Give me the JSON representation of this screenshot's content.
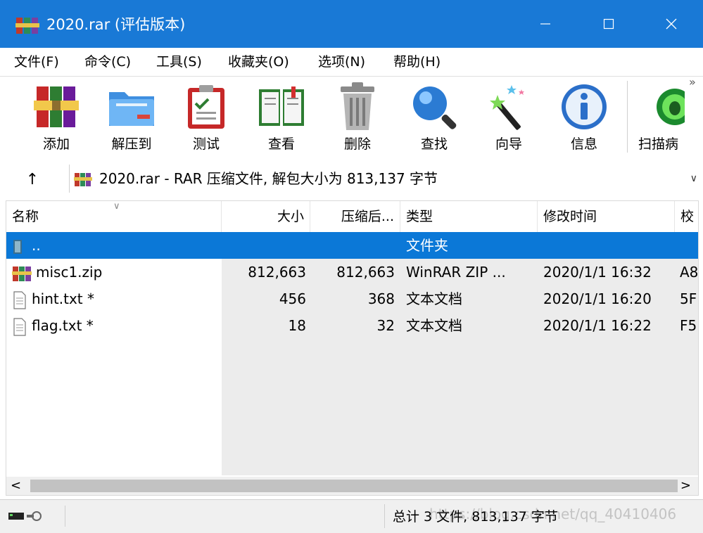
{
  "window": {
    "title": "2020.rar (评估版本)"
  },
  "menu": [
    "文件(F)",
    "命令(C)",
    "工具(S)",
    "收藏夹(O)",
    "选项(N)",
    "帮助(H)"
  ],
  "toolbar": [
    {
      "label": "添加",
      "icon": "add-books-icon"
    },
    {
      "label": "解压到",
      "icon": "extract-folder-icon"
    },
    {
      "label": "测试",
      "icon": "test-clipboard-icon"
    },
    {
      "label": "查看",
      "icon": "view-book-icon"
    },
    {
      "label": "删除",
      "icon": "trash-icon"
    },
    {
      "label": "查找",
      "icon": "magnifier-icon"
    },
    {
      "label": "向导",
      "icon": "wizard-wand-icon"
    },
    {
      "label": "信息",
      "icon": "info-icon"
    },
    {
      "label": "扫描病",
      "icon": "virus-scan-icon"
    }
  ],
  "address": {
    "text": "2020.rar - RAR 压缩文件, 解包大小为 813,137 字节"
  },
  "columns": [
    "名称",
    "大小",
    "压缩后...",
    "类型",
    "修改时间",
    "校"
  ],
  "files": [
    {
      "name": "..",
      "size": "",
      "packed": "",
      "type": "文件夹",
      "modified": "",
      "crc": "",
      "icon": "folder-icon",
      "selected": true
    },
    {
      "name": "misc1.zip",
      "size": "812,663",
      "packed": "812,663",
      "type": "WinRAR ZIP ...",
      "modified": "2020/1/1 16:32",
      "crc": "A8",
      "icon": "rar-archive-icon",
      "selected": false
    },
    {
      "name": "hint.txt *",
      "size": "456",
      "packed": "368",
      "type": "文本文档",
      "modified": "2020/1/1 16:20",
      "crc": "5F",
      "icon": "text-file-icon",
      "selected": false
    },
    {
      "name": "flag.txt *",
      "size": "18",
      "packed": "32",
      "type": "文本文档",
      "modified": "2020/1/1 16:22",
      "crc": "F5",
      "icon": "text-file-icon",
      "selected": false
    }
  ],
  "status": {
    "text": "总计 3 文件, 813,137 字节",
    "watermark": "https://blog.csdn.net/qq_40410406"
  },
  "colors": {
    "titlebar": "#1979d6",
    "selection": "#0b78d7"
  }
}
